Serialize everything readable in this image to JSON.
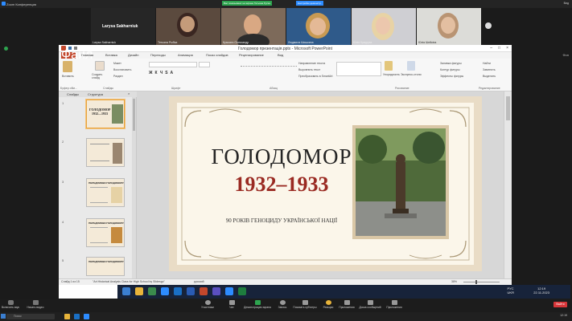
{
  "zoom": {
    "window_title": "Zoom Конференция",
    "badge_1": "Вас показывают на экране Тетьяна Руска",
    "badge_2": "Настройки демонстр.",
    "view_label": "Вид",
    "right_label": "Фон",
    "participants": [
      {
        "name": "Larysa Sakharniuk",
        "big": "Larysa Sakharniuk"
      },
      {
        "name": "Тетьяна Рыбка"
      },
      {
        "name": "Кузьмич Олександр"
      },
      {
        "name": "Людмила Шишкина"
      },
      {
        "name": "Юлія Кукуруза"
      },
      {
        "name": "Юлія Шейкіна"
      }
    ],
    "toolbar": {
      "mute": "Включить звук",
      "video": "Начать видео",
      "participants": "Участники",
      "chat": "Чат",
      "share": "Демонстрация экрана",
      "polls": "Запись",
      "record": "Показать субтитры",
      "reactions": "Реакции",
      "apps": "Приложения",
      "whiteboard": "Доска сообщений",
      "more": "Приложения",
      "end": "Выйти"
    }
  },
  "powerpoint": {
    "title": "Голодомор презентація.pptx - Microsoft PowerPoint",
    "tabs": [
      "Файл",
      "Главная",
      "Вставка",
      "Дизайн",
      "Переходы",
      "Анимация",
      "Показ слайдов",
      "Рецензирование",
      "Вид"
    ],
    "groups": [
      "Буфер обм...",
      "Слайды",
      "Шрифт",
      "Абзац",
      "Рисование",
      "Редактирование"
    ],
    "ribbon": {
      "paste": "Вставить",
      "new_slide": "Создать слайд",
      "layout": "Макет",
      "reset": "Восстановить",
      "section": "Раздел",
      "direction": "Направление текста",
      "align": "Выровнять текст",
      "smartart": "Преобразовать в SmartArt",
      "arrange": "Упорядочить",
      "quick_styles": "Экспресс-стили",
      "fill": "Заливка фигуры",
      "outline": "Контур фигуры",
      "effects": "Эффекты фигуры",
      "find": "Найти",
      "replace": "Заменить",
      "select": "Выделить"
    },
    "pane_tabs": [
      "Слайды",
      "Структура"
    ],
    "thumbnails": [
      {
        "num": "1",
        "title": "ГОЛОДОМОР 1932—1933"
      },
      {
        "num": "2",
        "title": ""
      },
      {
        "num": "3",
        "title": "ПЕРЕДУМОВИ ГОЛОДОМОРУ"
      },
      {
        "num": "4",
        "title": "ПЕРЕДУМОВИ ГОЛОДОМОРУ"
      },
      {
        "num": "5",
        "title": "ПЕРЕДУМОВИ ГОЛОДОМОРУ"
      }
    ],
    "slide": {
      "title": "ГОЛОДОМОР",
      "years": "1932–1933",
      "subtitle": "90 РОКІВ ГЕНОЦИДУ УКРАЇНСЬКОЇ НАЦІЇ"
    },
    "status": {
      "slide_info": "Слайд 1 из 15",
      "theme": "\"Art Historical Analysis Class for High School by Slidesgo\"",
      "language": "русский",
      "zoom": "38%"
    }
  },
  "taskbar": {
    "lang": "РУС\nUKR",
    "time": "12:19",
    "date": "22.11.2023"
  },
  "windows": {
    "search_placeholder": "Поиск",
    "time": "12:19"
  }
}
